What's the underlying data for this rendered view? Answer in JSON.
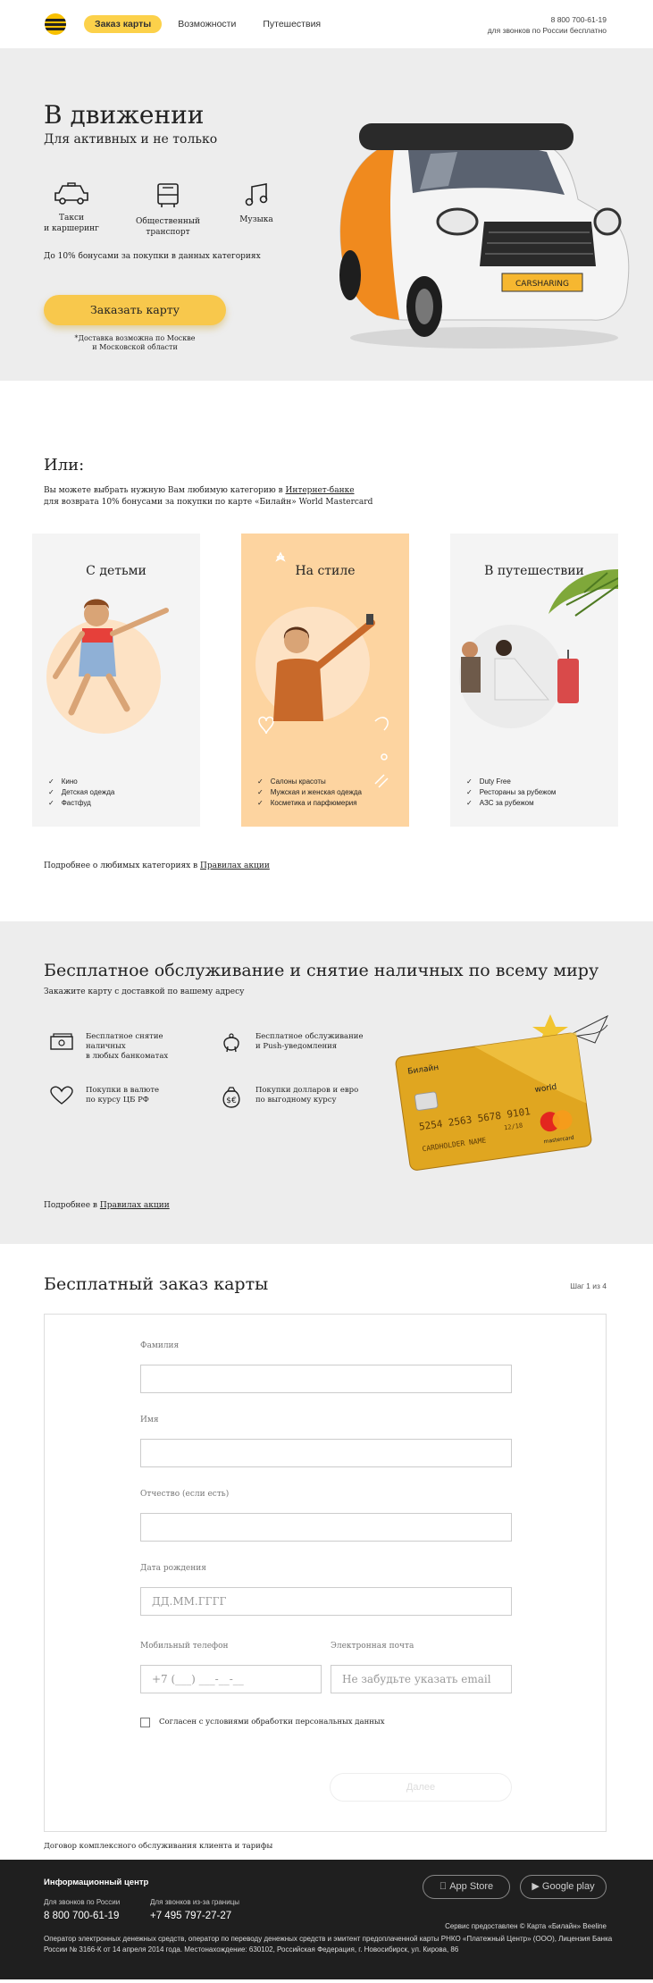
{
  "header": {
    "nav": [
      "Заказ карты",
      "Возможности",
      "Путешествия"
    ],
    "phone": "8 800 700-61-19",
    "phone_note": "для звонков по России бесплатно"
  },
  "hero": {
    "title": "В движении",
    "subtitle": "Для активных и не только",
    "features": [
      "Такси\nи каршеринг",
      "Общественный\nтранспорт",
      "Музыка"
    ],
    "bonus_note": "До 10% бонусами за покупки в данных категориях",
    "order_button": "Заказать карту",
    "delivery_note": "*Доставка возможна по Москве\nи Московской области",
    "car_plate": "CARSHARING"
  },
  "categories": {
    "title": "Или:",
    "text_1": "Вы можете выбрать нужную Вам любимую категорию в ",
    "text_link": "Интернет-банке",
    "text_2": "для возврата 10% бонусами за покупки по карте «Билайн» World Mastercard",
    "cards": [
      {
        "title": "С детьми",
        "items": [
          "Кино",
          "Детская одежда",
          "Фастфуд"
        ]
      },
      {
        "title": "На стиле",
        "items": [
          "Салоны красоты",
          "Мужская и женская одежда",
          "Косметика и парфюмерия"
        ]
      },
      {
        "title": "В путешествии",
        "items": [
          "Duty Free",
          "Рестораны за рубежом",
          "АЗС за рубежом"
        ]
      }
    ],
    "more_text": "Подробнее о любимых категориях в ",
    "more_link": "Правилах акции"
  },
  "service": {
    "title": "Бесплатное обслуживание и снятие наличных по всему миру",
    "subtitle": "Закажите карту с доставкой по вашему адресу",
    "items": [
      "Бесплатное снятие\nналичных\nв любых банкоматах",
      "Бесплатное обслуживание\nи Push-уведомления",
      "Покупки в валюте\nпо курсу ЦБ РФ",
      "Покупки долларов и евро\nпо выгодному курсу"
    ],
    "more_text": "Подробнее в ",
    "more_link": "Правилах акции",
    "card": {
      "bank": "Билайн",
      "number": "5254 2563 5678 9101",
      "valid": "12/18",
      "holder": "CARDHOLDER NAME",
      "world": "world",
      "brand": "mastercard"
    }
  },
  "form": {
    "title": "Бесплатный заказ карты",
    "step": "Шаг 1 из 4",
    "last_name_label": "Фамилия",
    "first_name_label": "Имя",
    "middle_name_label": "Отчество (если есть)",
    "birth_label": "Дата рождения",
    "birth_placeholder": "ДД.ММ.ГГГГ",
    "phone_label": "Мобильный телефон",
    "phone_placeholder": "+7 (___) ___-__-__",
    "email_label": "Электронная почта",
    "email_placeholder": "Не забудьте указать email",
    "consent": "Согласен с условиями обработки персональных данных",
    "next_button": "Далее",
    "contract_link": "Договор комплексного обслуживания клиента и тарифы"
  },
  "footer": {
    "title": "Информационный центр",
    "russia_label": "Для звонков по России",
    "russia_phone": "8 800 700-61-19",
    "abroad_label": "Для звонков из-за границы",
    "abroad_phone": "+7 495 797-27-27",
    "app_store": "App Store",
    "google_play": "Google play",
    "service_note": "Сервис предоставлен © Карта «Билайн» Beeline",
    "legal": "Оператор электронных денежных средств, оператор по переводу денежных средств и эмитент предоплаченной карты РНКО «Платежный Центр» (ООО), Лицензия Банка России № 3166-К от 14 апреля 2014 года. Местонахождение: 630102, Российская Федерация, г. Новосибирск, ул. Кирова, 86"
  }
}
